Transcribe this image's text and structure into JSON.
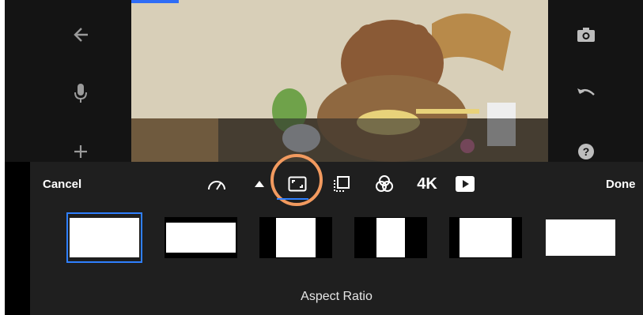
{
  "left_rail": {
    "buttons": [
      {
        "icon": "back-arrow-icon"
      },
      {
        "icon": "microphone-icon"
      },
      {
        "icon": "plus-icon"
      }
    ]
  },
  "right_rail": {
    "buttons": [
      {
        "icon": "camera-icon"
      },
      {
        "icon": "undo-icon"
      },
      {
        "icon": "help-icon"
      }
    ]
  },
  "toolbar": {
    "cancel_label": "Cancel",
    "done_label": "Done",
    "resolution_label": "4K",
    "tools": [
      "speed-icon",
      "expand-up-icon",
      "aspect-ratio-icon",
      "crop-layers-icon",
      "filters-icon",
      "resolution-4k",
      "youtube-play-icon"
    ],
    "active_tool": "aspect-ratio-icon"
  },
  "aspect_ratios": {
    "selected_index": 0,
    "items": [
      "option-1",
      "option-2",
      "option-3",
      "option-4",
      "option-5",
      "option-6"
    ]
  },
  "caption": "Aspect Ratio",
  "colors": {
    "accent": "#2f80ff",
    "highlight": "#f29a5f",
    "panel": "#1f1f1f"
  }
}
